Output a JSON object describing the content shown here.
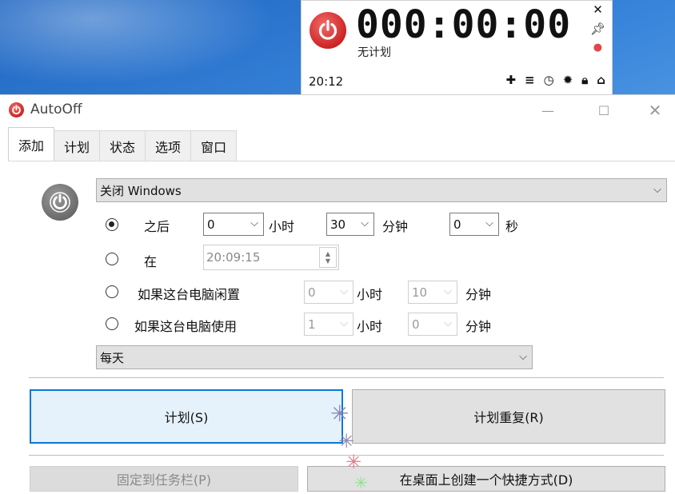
{
  "timer": {
    "display": "000:00:00",
    "status": "无计划",
    "clock": "20:12",
    "icons": [
      "close-icon",
      "pin-icon",
      "drop-icon",
      "plus-icon",
      "menu-icon",
      "clock-icon",
      "gear-icon",
      "lock-icon",
      "home-icon"
    ]
  },
  "window": {
    "title": "AutoOff",
    "tabs": [
      "添加",
      "计划",
      "状态",
      "选项",
      "窗口"
    ],
    "active_tab": "添加"
  },
  "form": {
    "action": "关闭 Windows",
    "after": {
      "label": "之后",
      "hours": "0",
      "hours_unit": "小时",
      "minutes": "30",
      "minutes_unit": "分钟",
      "seconds": "0",
      "seconds_unit": "秒"
    },
    "at": {
      "label": "在",
      "time": "20:09:15"
    },
    "idle": {
      "label": "如果这台电脑闲置",
      "hours": "0",
      "hours_unit": "小时",
      "minutes": "10",
      "minutes_unit": "分钟"
    },
    "busy": {
      "label": "如果这台电脑使用",
      "hours": "1",
      "hours_unit": "小时",
      "minutes": "0",
      "minutes_unit": "分钟"
    },
    "repeat": "每天"
  },
  "buttons": {
    "schedule": "计划(S)",
    "schedule_repeat": "计划重复(R)",
    "pin_taskbar": "固定到任务栏(P)",
    "desktop_shortcut": "在桌面上创建一个快捷方式(D)"
  }
}
